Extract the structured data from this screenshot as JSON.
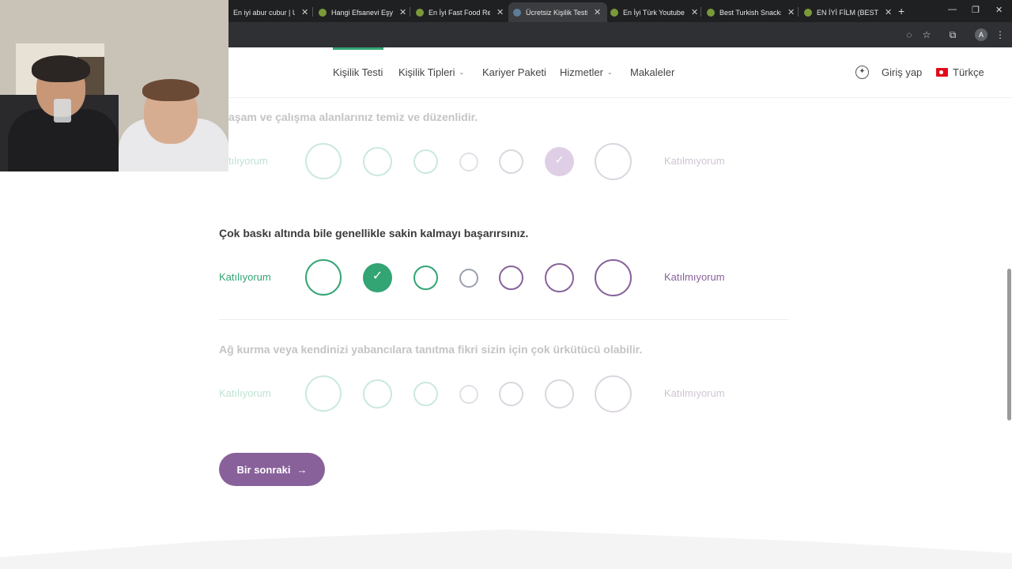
{
  "browser": {
    "tabs": [
      {
        "title": "En iyi abur cubur | Uv",
        "active": false
      },
      {
        "title": "Hangi Efsanevi Eşya S",
        "active": false
      },
      {
        "title": "En İyi Fast Food Resta",
        "active": false
      },
      {
        "title": "Ücretsiz Kişilik Testi |",
        "active": true
      },
      {
        "title": "En İyi Türk Youtuber",
        "active": false
      },
      {
        "title": "Best Turkish Snacks (",
        "active": false
      },
      {
        "title": "EN İYİ FİLM (BEST M",
        "active": false
      }
    ],
    "close_glyph": "✕",
    "new_tab_glyph": "+",
    "window_controls": {
      "minimize": "—",
      "restore": "❐",
      "close": "✕"
    },
    "toolbar_icons": {
      "eye_off": "◌",
      "star": "☆",
      "extensions": "⧉",
      "menu": "⋮"
    },
    "profile_initial": "A"
  },
  "header": {
    "nav": [
      {
        "label": "Kişilik Testi",
        "dropdown": false,
        "active": true
      },
      {
        "label": "Kişilik Tipleri",
        "dropdown": true,
        "active": false
      },
      {
        "label": "Kariyer Paketi",
        "dropdown": false,
        "active": false
      },
      {
        "label": "Hizmetler",
        "dropdown": true,
        "active": false
      },
      {
        "label": "Makaleler",
        "dropdown": false,
        "active": false
      }
    ],
    "chevron": "⌄",
    "accessibility_glyph": "✦",
    "login": "Giriş yap",
    "language": "Türkçe"
  },
  "questions": [
    {
      "text": "Yaşam ve çalışma alanlarınız temiz ve düzenlidir.",
      "visible_text": "aşam ve çalışma alanlarınız temiz ve düzenlidir.",
      "agree_label": "Katılıyorum",
      "visible_agree_label": "tılıyorum",
      "disagree_label": "Katılmıyorum",
      "selected_index": 5,
      "state": "faded"
    },
    {
      "text": "Çok baskı altında bile genellikle sakin kalmayı başarırsınız.",
      "agree_label": "Katılıyorum",
      "disagree_label": "Katılmıyorum",
      "selected_index": 1,
      "state": "active"
    },
    {
      "text": "Ağ kurma veya kendinizi yabancılara tanıtma fikri sizin için çok ürkütücü olabilir.",
      "agree_label": "Katılıyorum",
      "disagree_label": "Katılmıyorum",
      "selected_index": null,
      "state": "faded"
    }
  ],
  "checkmark": "✓",
  "next_button": {
    "label": "Bir sonraki",
    "arrow": "→"
  },
  "colors": {
    "agree_green": "#33a474",
    "disagree_purple": "#88619a",
    "neutral_gray": "#9b9faf",
    "browser_tabbar": "#1f2022",
    "browser_toolbar": "#2f3033"
  }
}
